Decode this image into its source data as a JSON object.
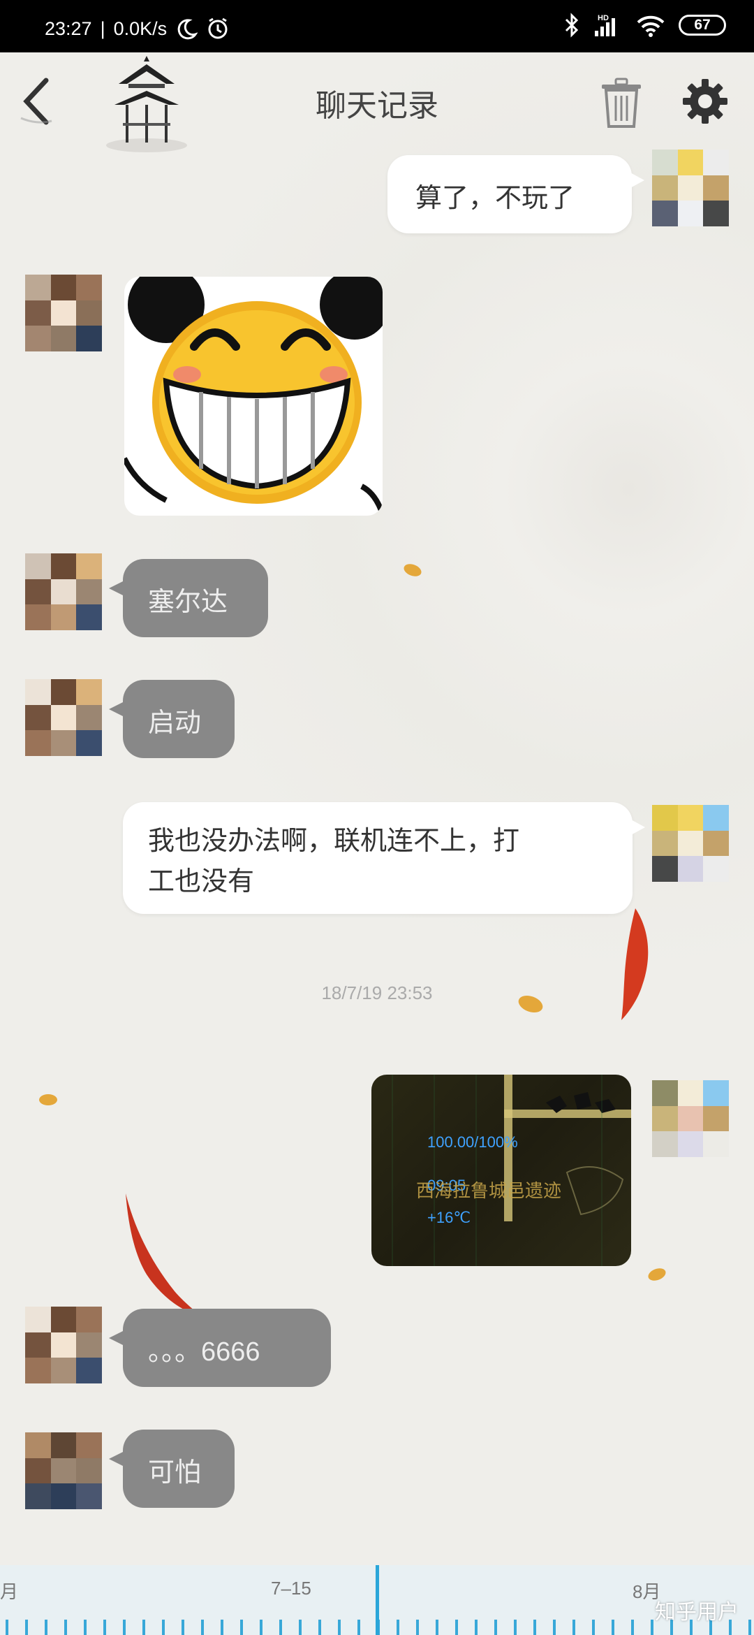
{
  "status_bar": {
    "time": "23:27",
    "network_speed": "0.0K/s",
    "battery": "67",
    "signal_label": "HD"
  },
  "header": {
    "title": "聊天记录",
    "back_icon": "chevron-left-icon",
    "delete_icon": "trash-icon",
    "settings_icon": "gear-icon"
  },
  "messages": [
    {
      "side": "right",
      "type": "text",
      "text": "算了，不玩了"
    },
    {
      "side": "left",
      "type": "sticker",
      "alt": "laughing-face-sticker"
    },
    {
      "side": "left",
      "type": "text",
      "text": "塞尔达"
    },
    {
      "side": "left",
      "type": "text",
      "text": "启动"
    },
    {
      "side": "right",
      "type": "text",
      "text_line1": "我也没办法啊，联机连不上，打",
      "text_line2": "工也没有"
    },
    {
      "side": "right",
      "type": "image",
      "alt": "game-screenshot",
      "overlay_line1": "100.00/100%",
      "overlay_line2": "09:05",
      "overlay_line3": "西海拉鲁城邑遗迹",
      "overlay_line4": "+16℃"
    },
    {
      "side": "left",
      "type": "text",
      "text": "。。。6666"
    },
    {
      "side": "left",
      "type": "text",
      "text": "可怕"
    }
  ],
  "timestamp": "18/7/19 23:53",
  "timeline": {
    "labels": [
      "月",
      "7–15",
      "8月"
    ]
  },
  "watermark": "知乎用户"
}
